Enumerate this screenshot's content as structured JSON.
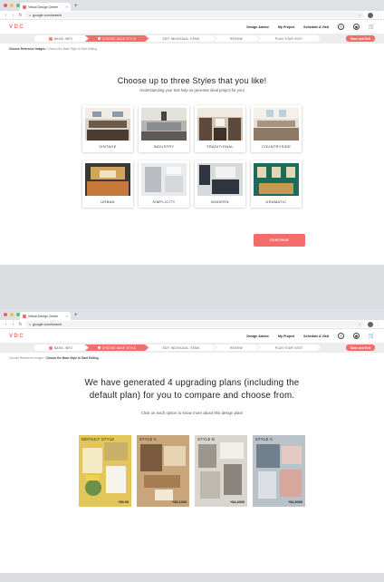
{
  "screen1": {
    "browser": {
      "tab_title": "Virtual Design Center",
      "tab_close": "×",
      "new_tab": "+",
      "url": "google.com/search"
    },
    "header": {
      "logo": "VDC",
      "nav": [
        "Design Advice",
        "My Project",
        "Schedule A Visit"
      ]
    },
    "steps": [
      {
        "label": "BASIC INFO",
        "state": "done"
      },
      {
        "label": "CHOOSE BASE STYLE",
        "state": "active"
      },
      {
        "label": "EDIT INDIVIDUAL ITEMS",
        "state": "pending"
      },
      {
        "label": "REVIEW",
        "state": "pending"
      },
      {
        "label": "PLAN YOUR VISIT",
        "state": "pending"
      }
    ],
    "save_exit": "Save and Exit",
    "breadcrumb": {
      "first": "Choose Reference Images",
      "sep": " / ",
      "current": "Choose the Base Style to Start Editing"
    },
    "title": "Choose up to three Styles that you like!",
    "subtitle": "Understanding your test help us generate ideal project for you!",
    "styles": [
      {
        "label": "VINTAGE",
        "accent": "#6b5a48"
      },
      {
        "label": "INDUSTRY",
        "accent": "#8a8d8f"
      },
      {
        "label": "TRADITIONAL",
        "accent": "#5d4a3c"
      },
      {
        "label": "COUNTRYSIDE",
        "accent": "#a7947f"
      },
      {
        "label": "URBAN",
        "accent": "#c67a3a"
      },
      {
        "label": "SIMPLICITY",
        "accent": "#b9bdc1"
      },
      {
        "label": "MODERN",
        "accent": "#2e3540"
      },
      {
        "label": "DRAMATIC",
        "accent": "#1f6b59"
      }
    ],
    "continue_label": "CONTINUE"
  },
  "screen2": {
    "browser": {
      "tab_title": "Virtual Design Center",
      "tab_close": "×",
      "new_tab": "+",
      "url": "google.com/search"
    },
    "header": {
      "logo": "VDC",
      "nav": [
        "Design Advice",
        "My Project",
        "Schedule A Visit"
      ]
    },
    "steps": [
      {
        "label": "BASIC INFO",
        "state": "done"
      },
      {
        "label": "CHOOSE BASE STYLE",
        "state": "active"
      },
      {
        "label": "EDIT INDIVIDUAL ITEMS",
        "state": "pending"
      },
      {
        "label": "REVIEW",
        "state": "pending"
      },
      {
        "label": "PLAN YOUR VISIT",
        "state": "pending"
      }
    ],
    "save_exit": "Save and Exit",
    "breadcrumb": {
      "first": "Choose Reference Images",
      "sep": " / ",
      "current": "Choose the Base Style to Start Editing"
    },
    "title": "We have generated 4 upgrading plans (including the default plan) for you to compare and choose from.",
    "subtitle": "Click on each option to know more about this design plan!",
    "plans": [
      {
        "name": "DEFAULT STYLE",
        "price": "+$0.00",
        "bg": "#e2c65a"
      },
      {
        "name": "STYLE A",
        "price": "+$5,1000",
        "bg": "#c9a57b"
      },
      {
        "name": "STYLE B",
        "price": "+$4,4000",
        "bg": "#d9d5cf"
      },
      {
        "name": "STYLE C",
        "price": "+$4,9000",
        "bg": "#b9c1c9"
      }
    ]
  },
  "colors": {
    "accent": "#f36d6a",
    "page_bg": "#dcdde0"
  }
}
